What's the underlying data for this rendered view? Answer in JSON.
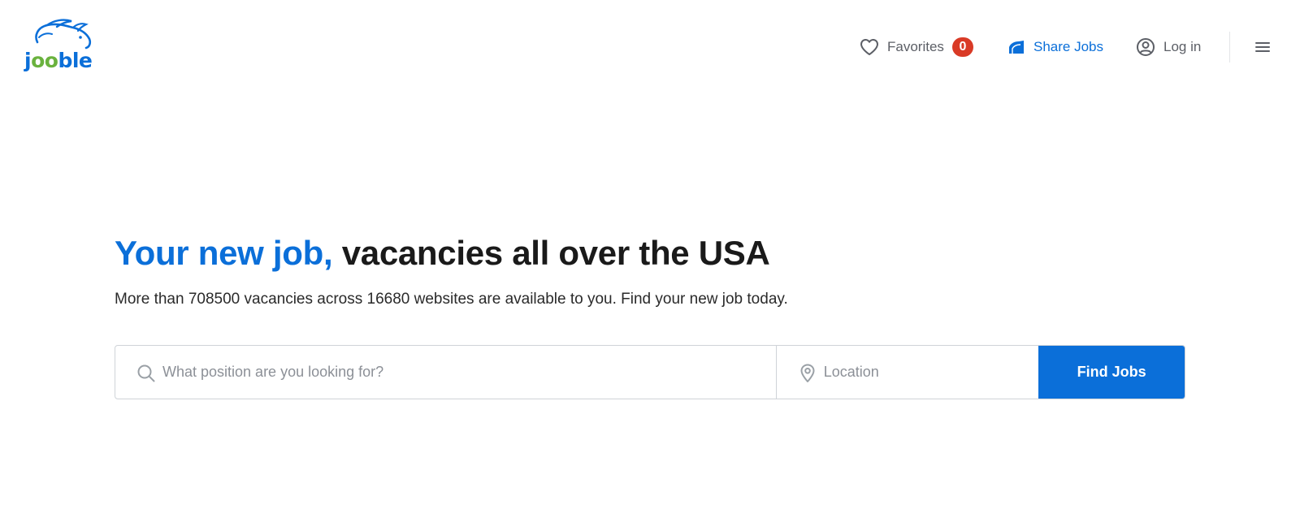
{
  "logo": {
    "part1": "j",
    "part2": "oo",
    "part3": "ble"
  },
  "nav": {
    "favorites_label": "Favorites",
    "favorites_count": "0",
    "share_label": "Share Jobs",
    "login_label": "Log in"
  },
  "hero": {
    "title_accent": "Your new job,",
    "title_rest": "vacancies all over the USA",
    "subtitle": "More than 708500 vacancies across 16680 websites are available to you. Find your new job today."
  },
  "search": {
    "position_placeholder": "What position are you looking for?",
    "position_value": "",
    "location_placeholder": "Location",
    "location_value": "",
    "button_label": "Find Jobs"
  },
  "icons": {
    "favorites": "heart-icon",
    "share": "share-icon",
    "login": "user-circle-icon",
    "menu": "hamburger-menu-icon",
    "search": "search-icon",
    "location": "location-pin-icon"
  },
  "colors": {
    "brand_blue": "#0b6fd9",
    "brand_green": "#6ab23e",
    "badge_red": "#d93a26",
    "nav_gray": "#5c5f66"
  }
}
